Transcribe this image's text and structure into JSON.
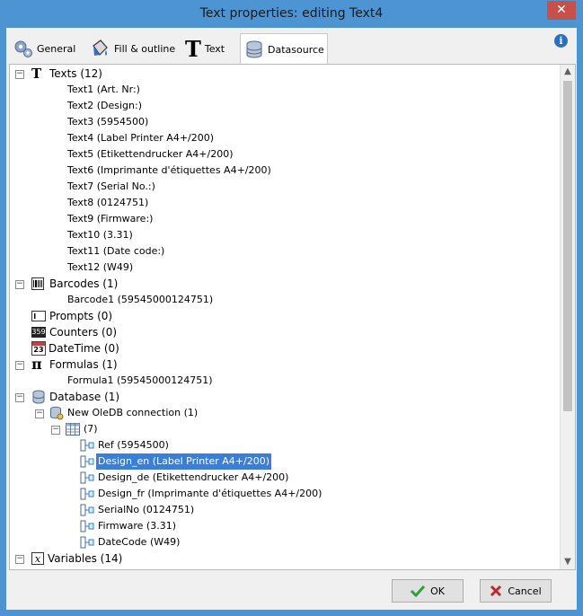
{
  "window": {
    "title": "Text properties: editing Text4",
    "close_glyph": "✕",
    "info_glyph": "i"
  },
  "tabs": [
    {
      "label": "General",
      "icon": "gears-icon"
    },
    {
      "label": "Fill & outline",
      "icon": "paint-bucket-icon"
    },
    {
      "label": "Text",
      "icon": "text-T-icon"
    },
    {
      "label": "Datasource",
      "icon": "database-icon"
    }
  ],
  "tree": {
    "texts": {
      "label": "Texts (12)",
      "icon_glyph": "T",
      "items": [
        "Text1 (Art. Nr:)",
        "Text2 (Design:)",
        "Text3 (5954500)",
        "Text4 (Label Printer A4+/200)",
        "Text5 (Etikettendrucker A4+/200)",
        "Text6 (Imprimante d'étiquettes A4+/200)",
        "Text7 (Serial No.:)",
        "Text8 (0124751)",
        "Text9 (Firmware:)",
        "Text10 (3.31)",
        "Text11 (Date code:)",
        "Text12 (W49)"
      ]
    },
    "barcodes": {
      "label": "Barcodes (1)",
      "items": [
        "Barcode1 (59545000124751)"
      ]
    },
    "prompts": {
      "label": "Prompts (0)"
    },
    "counters": {
      "label": "Counters (0)",
      "icon_glyph": "359"
    },
    "datetime": {
      "label": "DateTime (0)",
      "icon_glyph": "23"
    },
    "formulas": {
      "label": "Formulas (1)",
      "icon_glyph": "π",
      "items": [
        "Formula1 (59545000124751)"
      ]
    },
    "database": {
      "label": "Database (1)",
      "connection": {
        "label": "New OleDB connection (1)",
        "table": {
          "label": "(7)",
          "fields": [
            "Ref (5954500)",
            "Design_en (Label Printer A4+/200)",
            "Design_de (Etikettendrucker A4+/200)",
            "Design_fr (Imprimante d'étiquettes A4+/200)",
            "SerialNo (0124751)",
            "Firmware (3.31)",
            "DateCode (W49)"
          ],
          "selected_index": 1
        }
      }
    },
    "variables": {
      "label": "Variables (14)",
      "icon_glyph": "x"
    }
  },
  "buttons": {
    "ok": "OK",
    "cancel": "Cancel"
  },
  "colors": {
    "title_bar": "#4d94d3",
    "selection": "#3b7ed9",
    "close": "#c7504b",
    "ok_check": "#2e9e3e",
    "cancel_x": "#c0282b"
  },
  "expander": {
    "minus": "−"
  },
  "scroll": {
    "up": "▲",
    "down": "▼"
  }
}
